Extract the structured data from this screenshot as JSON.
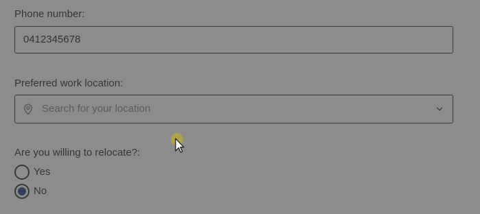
{
  "form": {
    "phone": {
      "label": "Phone number:",
      "value": "0412345678"
    },
    "location": {
      "label": "Preferred work location:",
      "placeholder": "Search for your location",
      "icon": "location-pin-icon",
      "dropdown_icon": "chevron-down-icon"
    },
    "relocate": {
      "question": "Are you willing to relocate?:",
      "options": [
        {
          "label": "Yes",
          "selected": false
        },
        {
          "label": "No",
          "selected": true
        }
      ]
    }
  },
  "ui": {
    "overlay_color": "#464646",
    "radio_checked_color": "#0c3b8f",
    "cursor_highlight_color": "#b9aa37"
  }
}
